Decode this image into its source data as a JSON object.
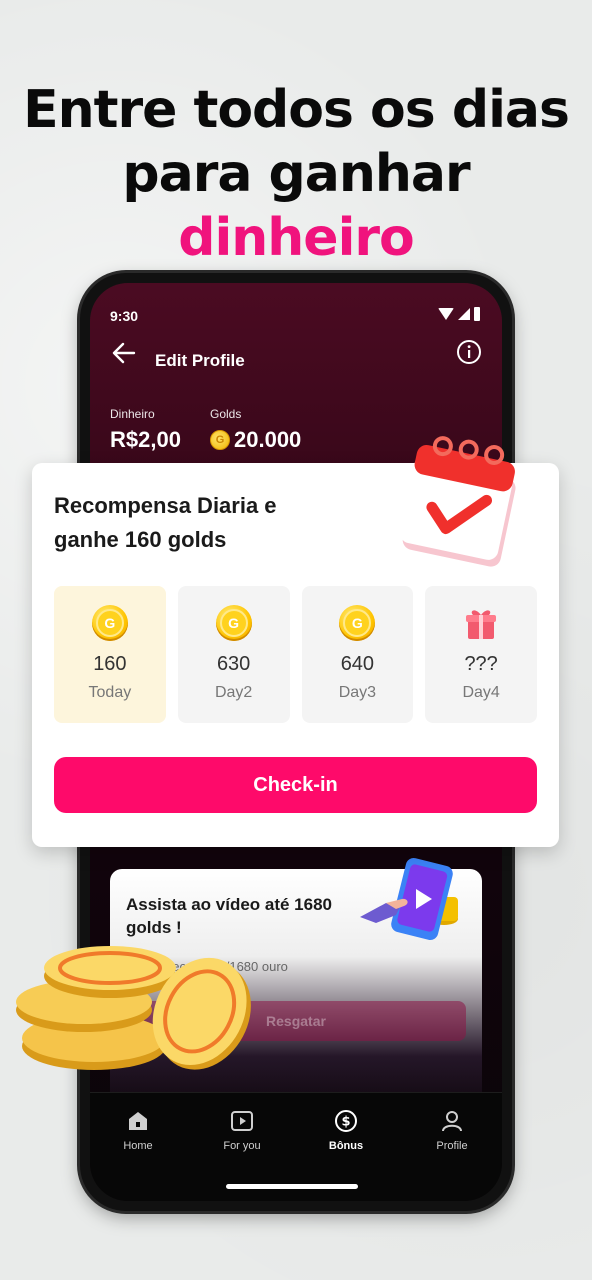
{
  "headline": {
    "line1": "Entre todos os dias",
    "line2_prefix": "para ganhar ",
    "line2_accent": "dinheiro"
  },
  "colors": {
    "accent": "#f0137d",
    "button": "#fe0a6a",
    "today_bg": "#fdf5dc"
  },
  "status": {
    "time": "9:30"
  },
  "topbar": {
    "title": "Edit Profile",
    "back_icon": "arrow-left-icon",
    "info_icon": "info-circle-icon"
  },
  "balance": {
    "money_label": "Dinheiro",
    "money_value": "R$2,00",
    "golds_label": "Golds",
    "golds_value": "20.000"
  },
  "reward": {
    "title": "Recompensa Diaria e ganhe 160 golds",
    "days": [
      {
        "amount": "160",
        "label": "Today",
        "icon": "gold-coin-icon"
      },
      {
        "amount": "630",
        "label": "Day2",
        "icon": "gold-coin-icon"
      },
      {
        "amount": "640",
        "label": "Day3",
        "icon": "gold-coin-icon"
      },
      {
        "amount": "???",
        "label": "Day4",
        "icon": "gift-icon"
      }
    ],
    "checkin_label": "Check-in"
  },
  "video_task": {
    "title": "Assista ao vídeo até 1680 golds !",
    "subtitle": "…ente recebeu 0/1680 ouro",
    "button_label": "Resgatar"
  },
  "nav": [
    {
      "label": "Home",
      "icon": "home-icon"
    },
    {
      "label": "For you",
      "icon": "play-icon"
    },
    {
      "label": "Bônus",
      "icon": "dollar-circle-icon",
      "active": true
    },
    {
      "label": "Profile",
      "icon": "person-icon"
    }
  ]
}
